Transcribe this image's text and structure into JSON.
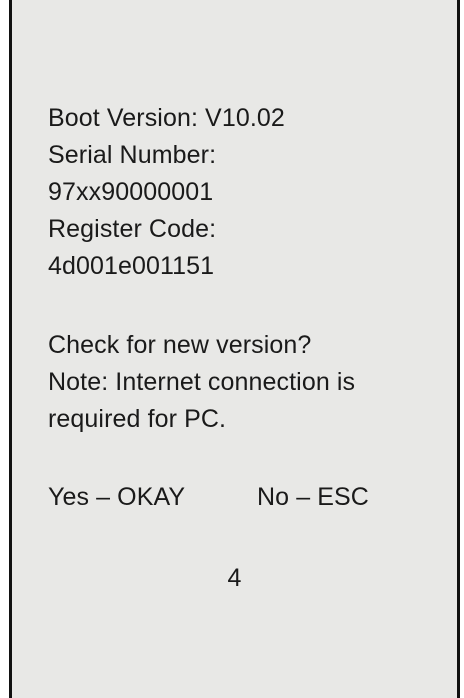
{
  "boot_info": {
    "boot_version": "Boot Version: V10.02",
    "serial_label": "Serial Number:",
    "serial_value": "97xx90000001",
    "register_label": "Register Code:",
    "register_value": "4d001e001151"
  },
  "prompt": {
    "question": "Check for new version?",
    "note_line1": "Note: Internet connection is",
    "note_line2": "required for PC."
  },
  "options": {
    "yes": "Yes – OKAY",
    "no": "No – ESC"
  },
  "page_number": "4"
}
